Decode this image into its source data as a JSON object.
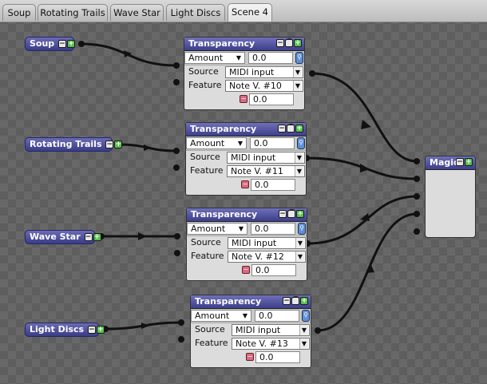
{
  "tabs": [
    {
      "label": "Soup",
      "active": false
    },
    {
      "label": "Rotating Trails",
      "active": false
    },
    {
      "label": "Wave Star",
      "active": false
    },
    {
      "label": "Light Discs",
      "active": false
    },
    {
      "label": "Scene 4",
      "active": true
    }
  ],
  "sources": [
    {
      "label": "Soup"
    },
    {
      "label": "Rotating Trails"
    },
    {
      "label": "Wave Star"
    },
    {
      "label": "Light Discs"
    }
  ],
  "transparency_nodes": [
    {
      "title": "Transparency",
      "amount_label": "Amount",
      "amount_value": "0.0",
      "source_label": "Source",
      "source_value": "MIDI input",
      "feature_label": "Feature",
      "feature_value": "Note V. #10",
      "output_value": "0.0"
    },
    {
      "title": "Transparency",
      "amount_label": "Amount",
      "amount_value": "0.0",
      "source_label": "Source",
      "source_value": "MIDI input",
      "feature_label": "Feature",
      "feature_value": "Note V. #11",
      "output_value": "0.0"
    },
    {
      "title": "Transparency",
      "amount_label": "Amount",
      "amount_value": "0.0",
      "source_label": "Source",
      "source_value": "MIDI input",
      "feature_label": "Feature",
      "feature_value": "Note V. #12",
      "output_value": "0.0"
    },
    {
      "title": "Transparency",
      "amount_label": "Amount",
      "amount_value": "0.0",
      "source_label": "Source",
      "source_value": "MIDI input",
      "feature_label": "Feature",
      "feature_value": "Note V. #13",
      "output_value": "0.0"
    }
  ],
  "magic": {
    "title": "Magic"
  },
  "colors": {
    "node_header": "#3d3e8a",
    "add_button": "#57c14b",
    "remove_button": "#d96a84",
    "lock_button": "#5d8ed8"
  }
}
